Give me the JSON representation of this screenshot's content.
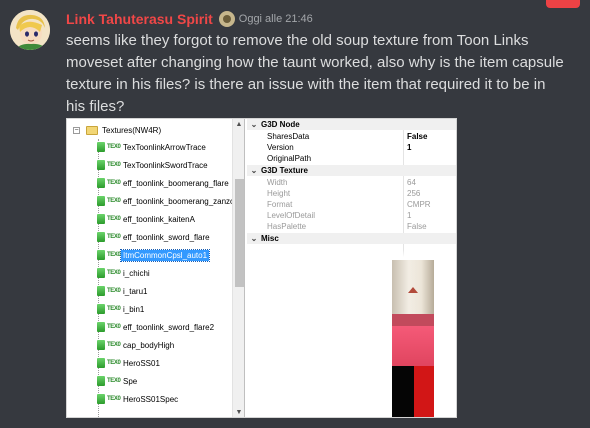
{
  "message": {
    "username": "Link Tahuterasu Spirit",
    "timestamp": "Oggi alle 21:46",
    "text": "seems like they forgot to remove the old soup texture from Toon Links moveset after changing how the taunt worked, also why is the item capsule texture in his files? is there an issue with the item that required it to be in his files?"
  },
  "screenshot": {
    "tree": {
      "folder_label": "Textures(NW4R)",
      "tex_badge": "TEX0",
      "items": [
        "TexToonlinkArrowTrace",
        "TexToonlinkSwordTrace",
        "eff_toonlink_boomerang_flare",
        "eff_toonlink_boomerang_zanzo",
        "eff_toonlink_kaitenA",
        "eff_toonlink_sword_flare",
        "ItmCommonCpsl_auto1",
        "i_chichi",
        "i_taru1",
        "i_bin1",
        "eff_toonlink_sword_flare2",
        "cap_bodyHigh",
        "HeroSS01",
        "Spe",
        "HeroSS01Spec"
      ],
      "selected_item": "ItmCommonCpsl_auto1",
      "scroll_up": "▲",
      "scroll_down": "▼"
    },
    "properties": {
      "cat_g3d_node": "G3D Node",
      "shares_data": {
        "name": "SharesData",
        "value": "False"
      },
      "version": {
        "name": "Version",
        "value": "1"
      },
      "original_path": {
        "name": "OriginalPath",
        "value": ""
      },
      "cat_g3d_texture": "G3D Texture",
      "width": {
        "name": "Width",
        "value": "64"
      },
      "height": {
        "name": "Height",
        "value": "256"
      },
      "format": {
        "name": "Format",
        "value": "CMPR"
      },
      "level_of_detail": {
        "name": "LevelOfDetail",
        "value": "1"
      },
      "has_palette": {
        "name": "HasPalette",
        "value": "False"
      },
      "cat_misc": "Misc",
      "chevron": "⌄"
    }
  },
  "colors": {
    "background": "#36393f",
    "username": "#f04747",
    "message_text": "#dcddde",
    "timestamp": "#a3a6aa",
    "selection": "#3399ff"
  },
  "icons": [
    "avatar-image",
    "role-badge-icon",
    "folder-icon",
    "tex0-icon",
    "capsule-texture-preview"
  ]
}
